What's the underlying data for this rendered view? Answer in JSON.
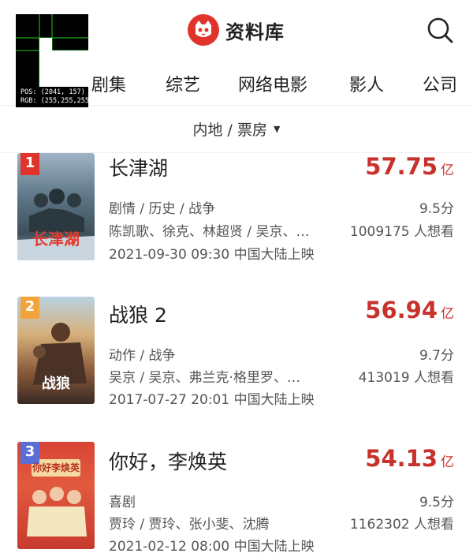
{
  "header": {
    "app_title": "资料库",
    "search_icon": "search-icon",
    "logo_icon": "cat-logo-icon",
    "brand_color": "#e0332b"
  },
  "debug_overlay": {
    "pos_text": "POS: (2041, 157)",
    "rgb_text": "RGB: (255,255,255)"
  },
  "tabs": [
    {
      "label": "剧集"
    },
    {
      "label": "综艺"
    },
    {
      "label": "网络电影"
    },
    {
      "label": "影人"
    },
    {
      "label": "公司"
    }
  ],
  "filter": {
    "label": "内地 / 票房",
    "caret_icon": "caret-down-icon"
  },
  "movies": [
    {
      "rank": "1",
      "rank_color": "#e0332b",
      "title": "长津湖",
      "box_office": "57.75",
      "unit": "亿",
      "genre": "剧情 / 历史 / 战争",
      "rating": "9.5分",
      "people": "陈凯歌、徐克、林超贤 / 吴京、…",
      "want": "1009175 人想看",
      "release": "2021-09-30 09:30 中国大陆上映",
      "poster_text": "长津湖"
    },
    {
      "rank": "2",
      "rank_color": "#f2a23a",
      "title": "战狼 2",
      "box_office": "56.94",
      "unit": "亿",
      "genre": "动作 / 战争",
      "rating": "9.7分",
      "people": "吴京 / 吴京、弗兰克·格里罗、…",
      "want": "413019 人想看",
      "release": "2017-07-27 20:01 中国大陆上映",
      "poster_text": "战狼"
    },
    {
      "rank": "3",
      "rank_color": "#5a6fd6",
      "title": "你好，李焕英",
      "box_office": "54.13",
      "unit": "亿",
      "genre": "喜剧",
      "rating": "9.5分",
      "people": "贾玲 / 贾玲、张小斐、沈腾",
      "want": "1162302 人想看",
      "release": "2021-02-12 08:00 中国大陆上映",
      "poster_text": "你好李焕英"
    }
  ]
}
